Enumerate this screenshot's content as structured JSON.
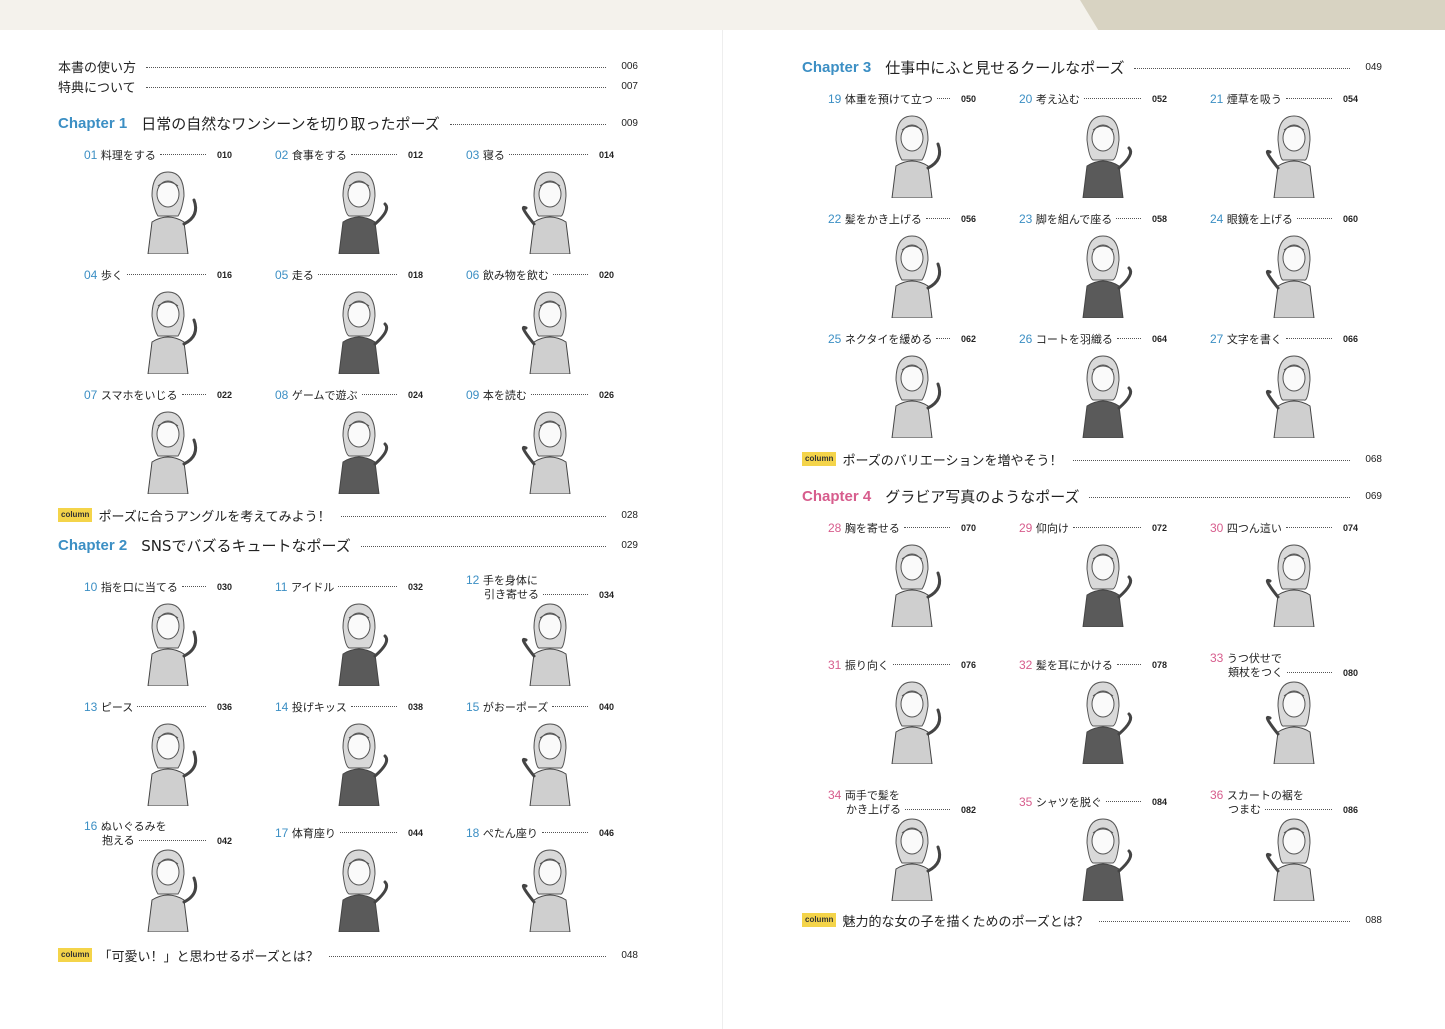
{
  "left": {
    "intro": [
      {
        "title": "本書の使い方",
        "page": "006"
      },
      {
        "title": "特典について",
        "page": "007"
      }
    ],
    "chapter1": {
      "label": "Chapter 1",
      "title": "日常の自然なワンシーンを切り取ったポーズ",
      "page": "009"
    },
    "ch1_poses": [
      {
        "num": "01",
        "title": "料理をする",
        "page": "010"
      },
      {
        "num": "02",
        "title": "食事をする",
        "page": "012"
      },
      {
        "num": "03",
        "title": "寝る",
        "page": "014"
      },
      {
        "num": "04",
        "title": "歩く",
        "page": "016"
      },
      {
        "num": "05",
        "title": "走る",
        "page": "018"
      },
      {
        "num": "06",
        "title": "飲み物を飲む",
        "page": "020"
      },
      {
        "num": "07",
        "title": "スマホをいじる",
        "page": "022"
      },
      {
        "num": "08",
        "title": "ゲームで遊ぶ",
        "page": "024"
      },
      {
        "num": "09",
        "title": "本を読む",
        "page": "026"
      }
    ],
    "column1": {
      "badge": "column",
      "title": "ポーズに合うアングルを考えてみよう！",
      "page": "028"
    },
    "chapter2": {
      "label": "Chapter 2",
      "title": "SNSでバズるキュートなポーズ",
      "page": "029"
    },
    "ch2_poses": [
      {
        "num": "10",
        "title": "指を口に当てる",
        "title2": "",
        "page": "030"
      },
      {
        "num": "11",
        "title": "アイドル",
        "title2": "",
        "page": "032"
      },
      {
        "num": "12",
        "title": "手を身体に",
        "title2": "引き寄せる",
        "page": "034"
      },
      {
        "num": "13",
        "title": "ピース",
        "title2": "",
        "page": "036"
      },
      {
        "num": "14",
        "title": "投げキッス",
        "title2": "",
        "page": "038"
      },
      {
        "num": "15",
        "title": "がおーポーズ",
        "title2": "",
        "page": "040"
      },
      {
        "num": "16",
        "title": "ぬいぐるみを",
        "title2": "抱える",
        "page": "042"
      },
      {
        "num": "17",
        "title": "体育座り",
        "title2": "",
        "page": "044"
      },
      {
        "num": "18",
        "title": "ぺたん座り",
        "title2": "",
        "page": "046"
      }
    ],
    "column2": {
      "badge": "column",
      "title": "「可愛い！」と思わせるポーズとは？",
      "page": "048"
    }
  },
  "right": {
    "chapter3": {
      "label": "Chapter 3",
      "title": "仕事中にふと見せるクールなポーズ",
      "page": "049"
    },
    "ch3_poses": [
      {
        "num": "19",
        "title": "体重を預けて立つ",
        "page": "050"
      },
      {
        "num": "20",
        "title": "考え込む",
        "page": "052"
      },
      {
        "num": "21",
        "title": "煙草を吸う",
        "page": "054"
      },
      {
        "num": "22",
        "title": "髪をかき上げる",
        "page": "056"
      },
      {
        "num": "23",
        "title": "脚を組んで座る",
        "page": "058"
      },
      {
        "num": "24",
        "title": "眼鏡を上げる",
        "page": "060"
      },
      {
        "num": "25",
        "title": "ネクタイを緩める",
        "page": "062"
      },
      {
        "num": "26",
        "title": "コートを羽織る",
        "page": "064"
      },
      {
        "num": "27",
        "title": "文字を書く",
        "page": "066"
      }
    ],
    "column3": {
      "badge": "column",
      "title": "ポーズのバリエーションを増やそう！",
      "page": "068"
    },
    "chapter4": {
      "label": "Chapter 4",
      "title": "グラビア写真のようなポーズ",
      "page": "069"
    },
    "ch4_poses": [
      {
        "num": "28",
        "title": "胸を寄せる",
        "title2": "",
        "page": "070"
      },
      {
        "num": "29",
        "title": "仰向け",
        "title2": "",
        "page": "072"
      },
      {
        "num": "30",
        "title": "四つん這い",
        "title2": "",
        "page": "074"
      },
      {
        "num": "31",
        "title": "振り向く",
        "title2": "",
        "page": "076"
      },
      {
        "num": "32",
        "title": "髪を耳にかける",
        "title2": "",
        "page": "078"
      },
      {
        "num": "33",
        "title": "うつ伏せで",
        "title2": "頬杖をつく",
        "page": "080"
      },
      {
        "num": "34",
        "title": "両手で髪を",
        "title2": "かき上げる",
        "page": "082"
      },
      {
        "num": "35",
        "title": "シャツを脱ぐ",
        "title2": "",
        "page": "084"
      },
      {
        "num": "36",
        "title": "スカートの裾を",
        "title2": "つまむ",
        "page": "086"
      }
    ],
    "column4": {
      "badge": "column",
      "title": "魅力的な女の子を描くためのポーズとは？",
      "page": "088"
    }
  },
  "colors": {
    "chapter_blue": "#3c8fc4",
    "chapter_pink": "#d75d8d",
    "column_badge": "#f4d44a"
  }
}
